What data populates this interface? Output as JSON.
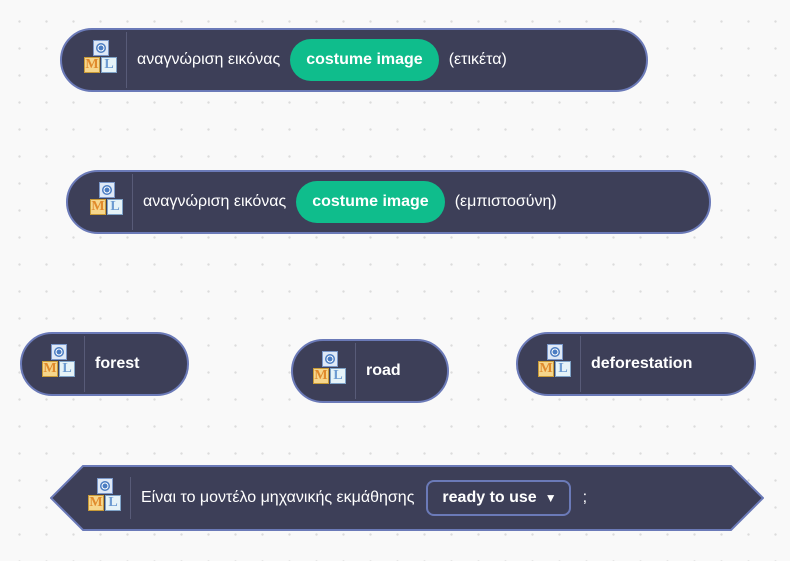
{
  "blocks": {
    "label_block": {
      "text": "αναγνώριση εικόνας",
      "input": "costume image",
      "suffix": "(ετικέτα)"
    },
    "confidence_block": {
      "text": "αναγνώριση εικόνας",
      "input": "costume image",
      "suffix": "(εμπιστοσύνη)"
    },
    "labels": [
      {
        "text": "forest"
      },
      {
        "text": "road"
      },
      {
        "text": "deforestation"
      }
    ],
    "model_ready": {
      "text": "Είναι το μοντέλο μηχανικής εκμάθησης",
      "dropdown": "ready to use",
      "suffix": ";"
    }
  },
  "colors": {
    "block_bg": "#3d3f58",
    "block_border": "#6b7ab8",
    "input_pill": "#0fbd8c",
    "workspace_bg": "#f9f9f9"
  },
  "icons": {
    "ml_icon": "ml-blocks-icon"
  }
}
